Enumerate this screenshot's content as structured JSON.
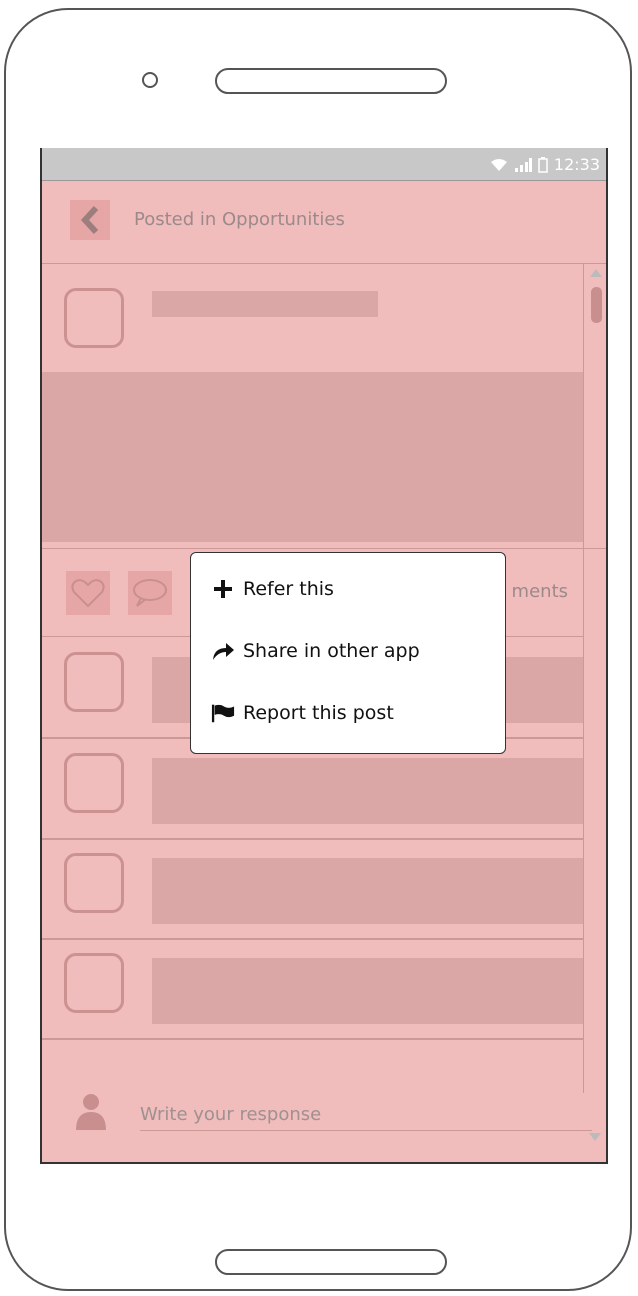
{
  "status_bar": {
    "time": "12:33",
    "icons": [
      "wifi-icon",
      "signal-icon",
      "battery-icon"
    ]
  },
  "header": {
    "back_icon": "chevron-left-icon",
    "title": "Posted in Opportunities"
  },
  "post": {
    "actions": {
      "like_icon": "heart-icon",
      "comment_icon": "speech-bubble-icon",
      "comments_label": "ments"
    }
  },
  "context_menu": {
    "items": [
      {
        "label": "Refer this",
        "icon": "plus-icon"
      },
      {
        "label": "Share in other app",
        "icon": "share-arrow-icon"
      },
      {
        "label": "Report this post",
        "icon": "flag-icon"
      }
    ]
  },
  "response": {
    "placeholder": "Write your response",
    "icon": "person-icon"
  },
  "colors": {
    "overlay": "#f0bcbc",
    "placeholder_block": "#dba6a6",
    "status_bar": "#c8c8c8"
  }
}
